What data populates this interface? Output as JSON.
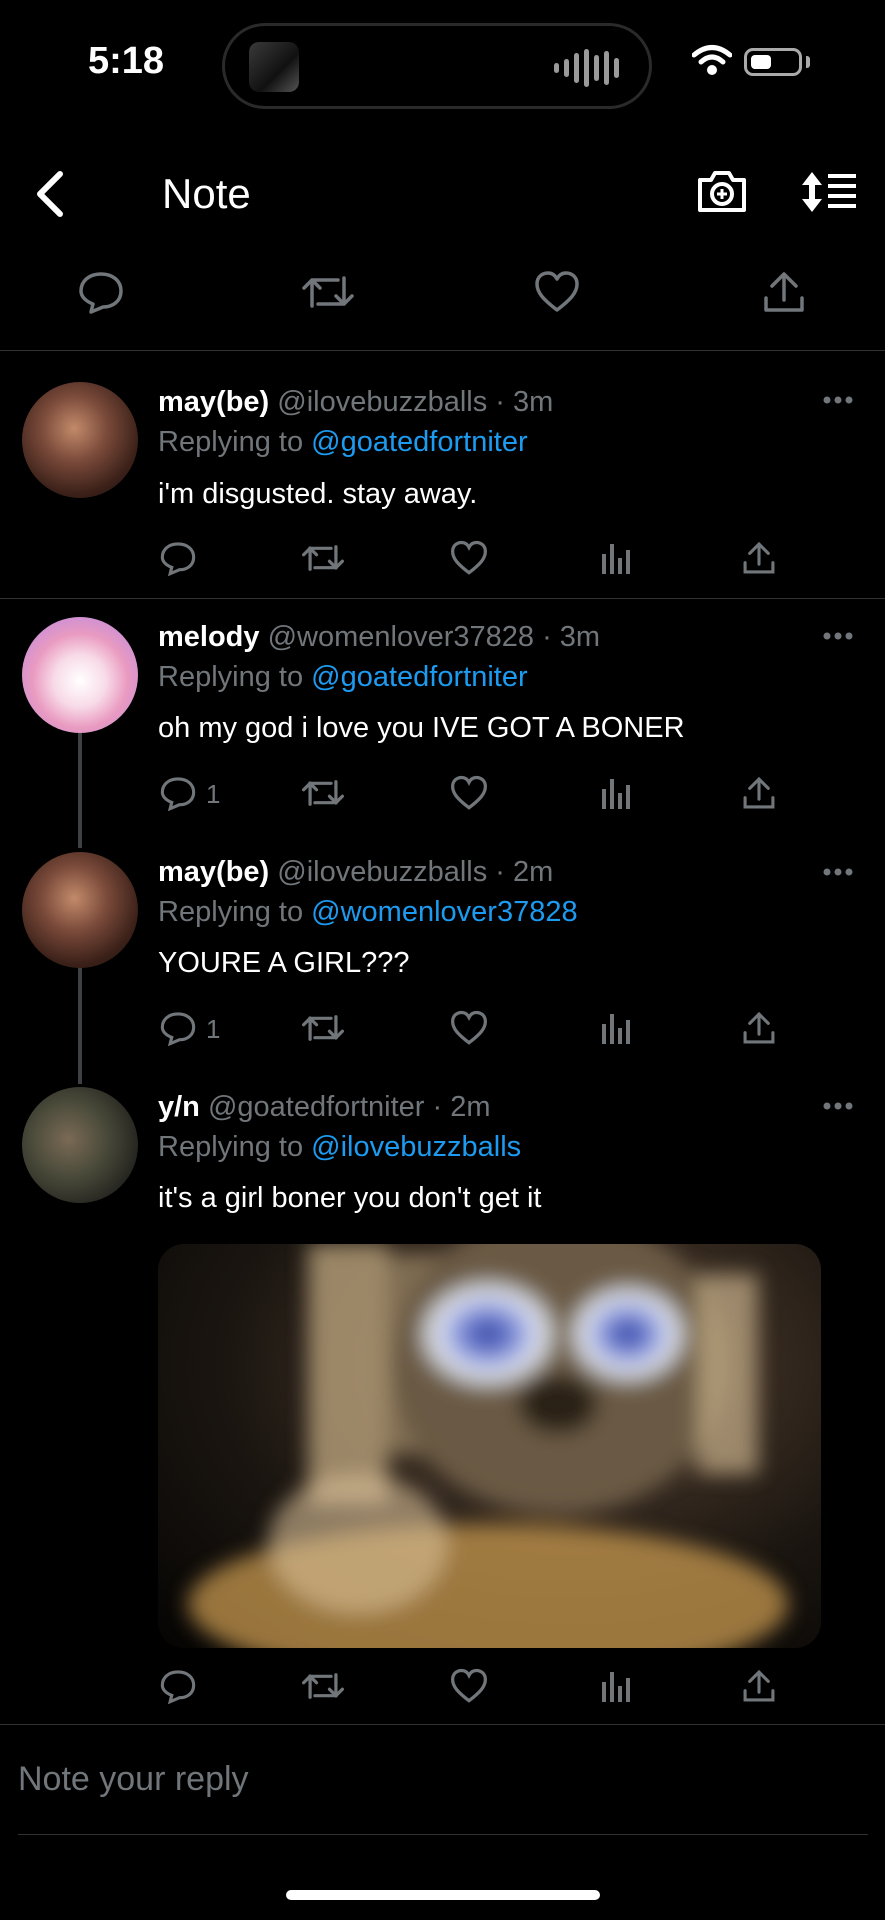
{
  "status_bar": {
    "time": "5:18"
  },
  "header": {
    "title": "Note"
  },
  "tweets": [
    {
      "name": "may(be)",
      "handle": "@ilovebuzzballs · 3m",
      "replying_label": "Replying to ",
      "replying_to": "@goatedfortniter",
      "text": "i'm disgusted. stay away.",
      "reply_count": ""
    },
    {
      "name": "melody",
      "handle": "@womenlover37828 · 3m",
      "replying_label": "Replying to ",
      "replying_to": "@goatedfortniter",
      "text": "oh my god i love you IVE GOT A BONER",
      "reply_count": "1"
    },
    {
      "name": "may(be)",
      "handle": "@ilovebuzzballs · 2m",
      "replying_label": "Replying to ",
      "replying_to": "@womenlover37828",
      "text": "YOURE A GIRL???",
      "reply_count": "1"
    },
    {
      "name": "y/n",
      "handle": "@goatedfortniter · 2m",
      "replying_label": "Replying to ",
      "replying_to": "@ilovebuzzballs",
      "text": "it's a girl boner you don't get it",
      "reply_count": ""
    }
  ],
  "composer": {
    "placeholder": "Note your reply"
  },
  "colors": {
    "accent": "#1d9bf0",
    "muted": "#71767b",
    "background": "#000000",
    "divider": "#2f3336"
  },
  "icons": [
    "back-icon",
    "camera-icon",
    "sort-icon",
    "reply-icon",
    "retweet-icon",
    "like-icon",
    "views-icon",
    "share-icon",
    "more-icon"
  ]
}
